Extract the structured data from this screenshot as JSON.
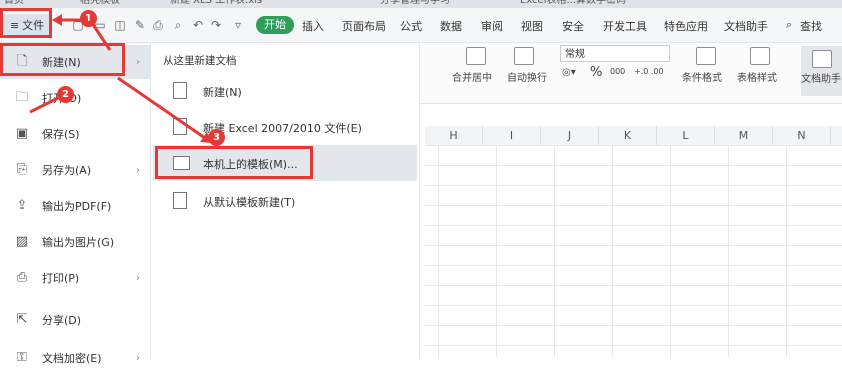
{
  "top_tabs": [
    "首页",
    "稻壳模板",
    "新建 XLS 工作表.xls",
    "分享管理与学习",
    "Excel表格...算数学密码"
  ],
  "file_label": "文件",
  "ribbon_tabs": [
    "开始",
    "插入",
    "页面布局",
    "公式",
    "数据",
    "审阅",
    "视图",
    "安全",
    "开发工具",
    "特色应用",
    "文档助手",
    "查找"
  ],
  "ribbon": {
    "number_format": "常规",
    "merge_label": "合并居中",
    "wrap_label": "自动换行",
    "cond_format_label": "条件格式",
    "table_style_label": "表格样式",
    "doc_assist_label": "文档助手",
    "percent": "%",
    "thousands": "000",
    "decimals": "+.0 .00"
  },
  "file_menu": {
    "items": [
      {
        "label": "新建(N)",
        "icon": "new-doc-icon",
        "has_submenu": true
      },
      {
        "label": "打开(O)",
        "icon": "folder-icon",
        "has_submenu": false
      },
      {
        "label": "保存(S)",
        "icon": "save-icon",
        "has_submenu": false
      },
      {
        "label": "另存为(A)",
        "icon": "save-as-icon",
        "has_submenu": true
      },
      {
        "label": "输出为PDF(F)",
        "icon": "pdf-icon",
        "has_submenu": false
      },
      {
        "label": "输出为图片(G)",
        "icon": "image-icon",
        "has_submenu": false
      },
      {
        "label": "打印(P)",
        "icon": "print-icon",
        "has_submenu": true
      },
      {
        "label": "分享(D)",
        "icon": "share-icon",
        "has_submenu": false
      },
      {
        "label": "文档加密(E)",
        "icon": "lock-icon",
        "has_submenu": true
      }
    ]
  },
  "new_submenu": {
    "title": "从这里新建文档",
    "items": [
      {
        "label": "新建(N)",
        "icon": "new-doc-icon"
      },
      {
        "label": "新建 Excel 2007/2010 文件(E)",
        "icon": "new-excel-icon"
      },
      {
        "label": "本机上的模板(M)...",
        "icon": "local-template-icon"
      },
      {
        "label": "从默认模板新建(T)",
        "icon": "default-template-icon"
      }
    ]
  },
  "columns": [
    "H",
    "I",
    "J",
    "K",
    "L",
    "M",
    "N"
  ],
  "annotations": [
    "1",
    "2",
    "3"
  ],
  "colors": {
    "accent_green": "#2f9e5b",
    "annotation_red": "#e53935",
    "hover_gray": "#e3e6ea"
  }
}
